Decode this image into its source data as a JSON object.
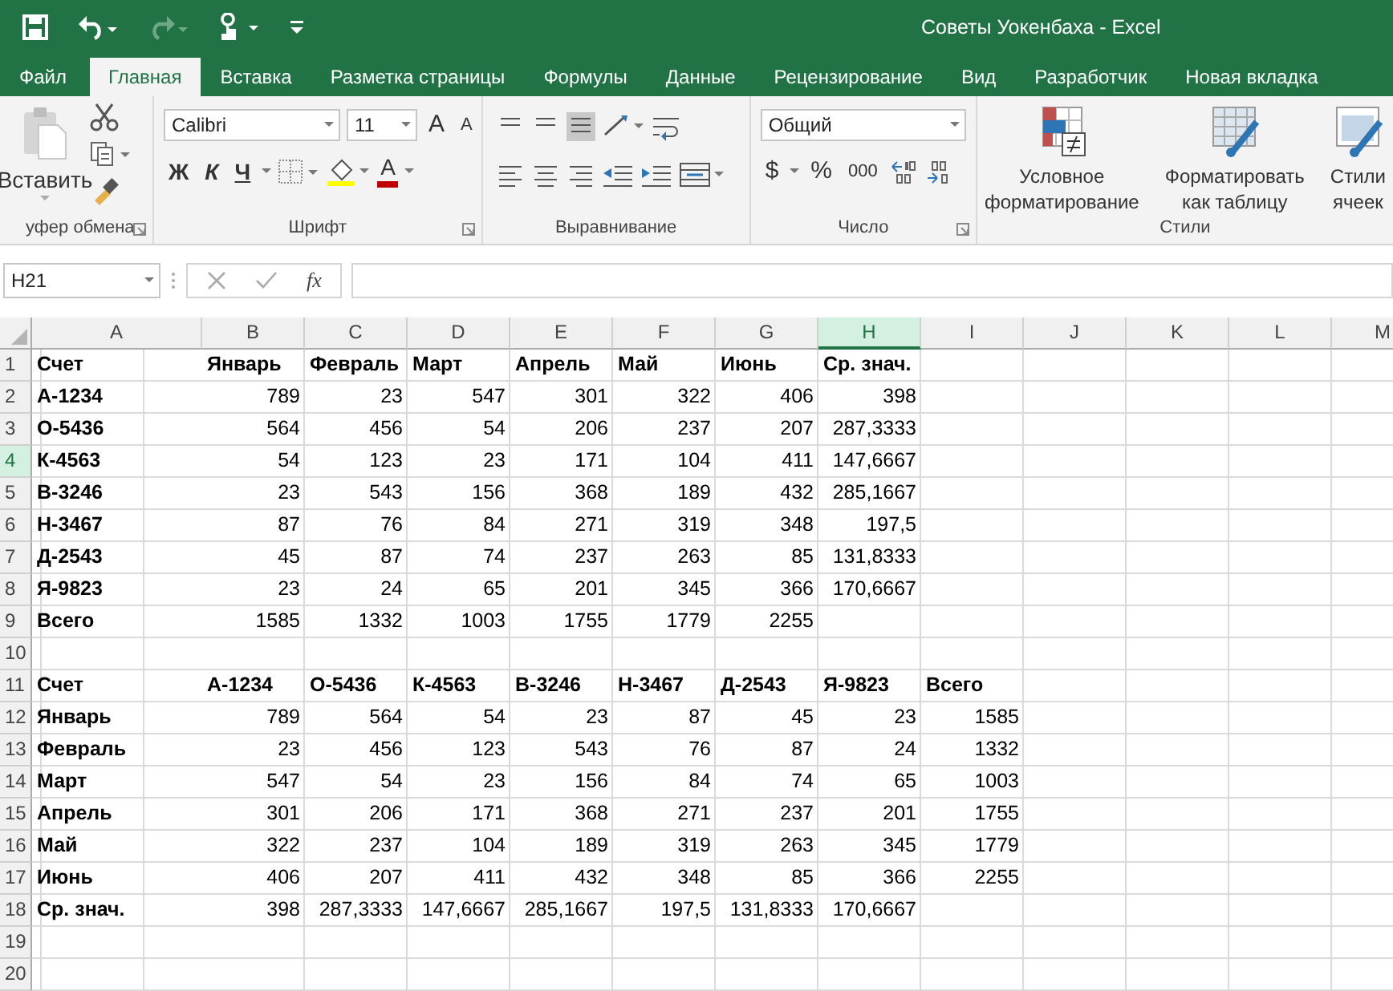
{
  "title_bar": {
    "title": "Советы Уокенбаха - Excel"
  },
  "tabs": [
    {
      "label": "Файл",
      "selected": false
    },
    {
      "label": "Главная",
      "selected": true
    },
    {
      "label": "Вставка",
      "selected": false
    },
    {
      "label": "Разметка страницы",
      "selected": false
    },
    {
      "label": "Формулы",
      "selected": false
    },
    {
      "label": "Данные",
      "selected": false
    },
    {
      "label": "Рецензирование",
      "selected": false
    },
    {
      "label": "Вид",
      "selected": false
    },
    {
      "label": "Разработчик",
      "selected": false
    },
    {
      "label": "Новая вкладка",
      "selected": false
    }
  ],
  "ribbon": {
    "clipboard": {
      "paste_label": "Вставить",
      "group_label": "уфер обмена"
    },
    "font": {
      "font_name": "Calibri",
      "font_size": "11",
      "grow": "A",
      "shrink": "A",
      "bold": "Ж",
      "italic": "К",
      "underline": "Ч",
      "font_color": "A",
      "group_label": "Шрифт"
    },
    "alignment": {
      "group_label": "Выравнивание"
    },
    "number": {
      "format": "Общий",
      "currency": "$",
      "percent": "%",
      "thousands": "000",
      "group_label": "Число"
    },
    "styles": {
      "buttons": [
        "Условное форматирование",
        "Форматировать как таблицу",
        "Стили ячеек"
      ],
      "group_label": "Стили"
    }
  },
  "formula_bar": {
    "name_box": "H21",
    "fx": "fx"
  },
  "sheet": {
    "columns": [
      {
        "label": "A",
        "selected": false
      },
      {
        "label": "B",
        "selected": false
      },
      {
        "label": "C",
        "selected": false
      },
      {
        "label": "D",
        "selected": false
      },
      {
        "label": "E",
        "selected": false
      },
      {
        "label": "F",
        "selected": false
      },
      {
        "label": "G",
        "selected": false
      },
      {
        "label": "H",
        "selected": true
      },
      {
        "label": "I",
        "selected": false
      },
      {
        "label": "J",
        "selected": false
      },
      {
        "label": "K",
        "selected": false
      },
      {
        "label": "L",
        "selected": false
      },
      {
        "label": "M",
        "selected": false
      }
    ],
    "rows": [
      {
        "number": "1",
        "selected": false,
        "kind": "header",
        "cells": [
          "Счет",
          "Январь",
          "Февраль",
          "Март",
          "Апрель",
          "Май",
          "Июнь",
          "Ср. знач."
        ]
      },
      {
        "number": "2",
        "selected": false,
        "kind": "data",
        "cells": [
          "А-1234",
          "789",
          "23",
          "547",
          "301",
          "322",
          "406",
          "398"
        ]
      },
      {
        "number": "3",
        "selected": false,
        "kind": "data",
        "cells": [
          "О-5436",
          "564",
          "456",
          "54",
          "206",
          "237",
          "207",
          "287,3333"
        ]
      },
      {
        "number": "4",
        "selected": true,
        "kind": "data",
        "cells": [
          "К-4563",
          "54",
          "123",
          "23",
          "171",
          "104",
          "411",
          "147,6667"
        ]
      },
      {
        "number": "5",
        "selected": false,
        "kind": "data",
        "cells": [
          "В-3246",
          "23",
          "543",
          "156",
          "368",
          "189",
          "432",
          "285,1667"
        ]
      },
      {
        "number": "6",
        "selected": false,
        "kind": "data",
        "cells": [
          "Н-3467",
          "87",
          "76",
          "84",
          "271",
          "319",
          "348",
          "197,5"
        ]
      },
      {
        "number": "7",
        "selected": false,
        "kind": "data",
        "cells": [
          "Д-2543",
          "45",
          "87",
          "74",
          "237",
          "263",
          "85",
          "131,8333"
        ]
      },
      {
        "number": "8",
        "selected": false,
        "kind": "data",
        "cells": [
          "Я-9823",
          "23",
          "24",
          "65",
          "201",
          "345",
          "366",
          "170,6667"
        ]
      },
      {
        "number": "9",
        "selected": false,
        "kind": "data",
        "cells": [
          "Всего",
          "1585",
          "1332",
          "1003",
          "1755",
          "1779",
          "2255"
        ]
      },
      {
        "number": "10",
        "selected": false
      },
      {
        "number": "11",
        "selected": false,
        "kind": "header",
        "cells": [
          "Счет",
          "А-1234",
          "О-5436",
          "К-4563",
          "В-3246",
          "Н-3467",
          "Д-2543",
          "Я-9823",
          "Всего"
        ]
      },
      {
        "number": "12",
        "selected": false,
        "kind": "data",
        "cells": [
          "Январь",
          "789",
          "564",
          "54",
          "23",
          "87",
          "45",
          "23",
          "1585"
        ]
      },
      {
        "number": "13",
        "selected": false,
        "kind": "data",
        "cells": [
          "Февраль",
          "23",
          "456",
          "123",
          "543",
          "76",
          "87",
          "24",
          "1332"
        ]
      },
      {
        "number": "14",
        "selected": false,
        "kind": "data",
        "cells": [
          "Март",
          "547",
          "54",
          "23",
          "156",
          "84",
          "74",
          "65",
          "1003"
        ]
      },
      {
        "number": "15",
        "selected": false,
        "kind": "data",
        "cells": [
          "Апрель",
          "301",
          "206",
          "171",
          "368",
          "271",
          "237",
          "201",
          "1755"
        ]
      },
      {
        "number": "16",
        "selected": false,
        "kind": "data",
        "cells": [
          "Май",
          "322",
          "237",
          "104",
          "189",
          "319",
          "263",
          "345",
          "1779"
        ]
      },
      {
        "number": "17",
        "selected": false,
        "kind": "data",
        "cells": [
          "Июнь",
          "406",
          "207",
          "411",
          "432",
          "348",
          "85",
          "366",
          "2255"
        ]
      },
      {
        "number": "18",
        "selected": false,
        "kind": "data",
        "cells": [
          "Ср. знач.",
          "398",
          "287,3333",
          "147,6667",
          "285,1667",
          "197,5",
          "131,8333",
          "170,6667"
        ]
      },
      {
        "number": "19",
        "selected": false
      },
      {
        "number": "20",
        "selected": false
      }
    ]
  }
}
